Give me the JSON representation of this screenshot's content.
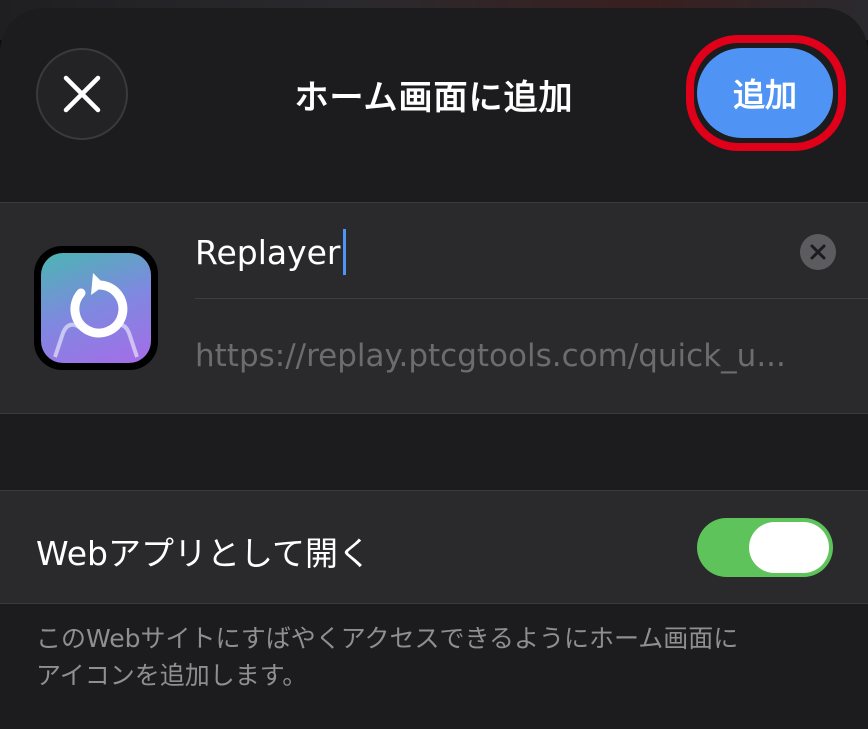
{
  "header": {
    "title": "ホーム画面に追加",
    "add_label": "追加",
    "close_icon": "close-icon"
  },
  "app": {
    "name_value": "Replayer",
    "url": "https://replay.ptcgtools.com/quick_u...",
    "icon": "replay-arrow-icon"
  },
  "settings": {
    "web_app_label": "Webアプリとして開く",
    "web_app_enabled": true
  },
  "footer": {
    "line1": "このWebサイトにすばやくアクセスできるようにホーム画面に",
    "line2": "アイコンを追加します。"
  },
  "colors": {
    "accent": "#4f93f5",
    "toggle_on": "#5ec35b",
    "highlight_outline": "#e0001a"
  }
}
